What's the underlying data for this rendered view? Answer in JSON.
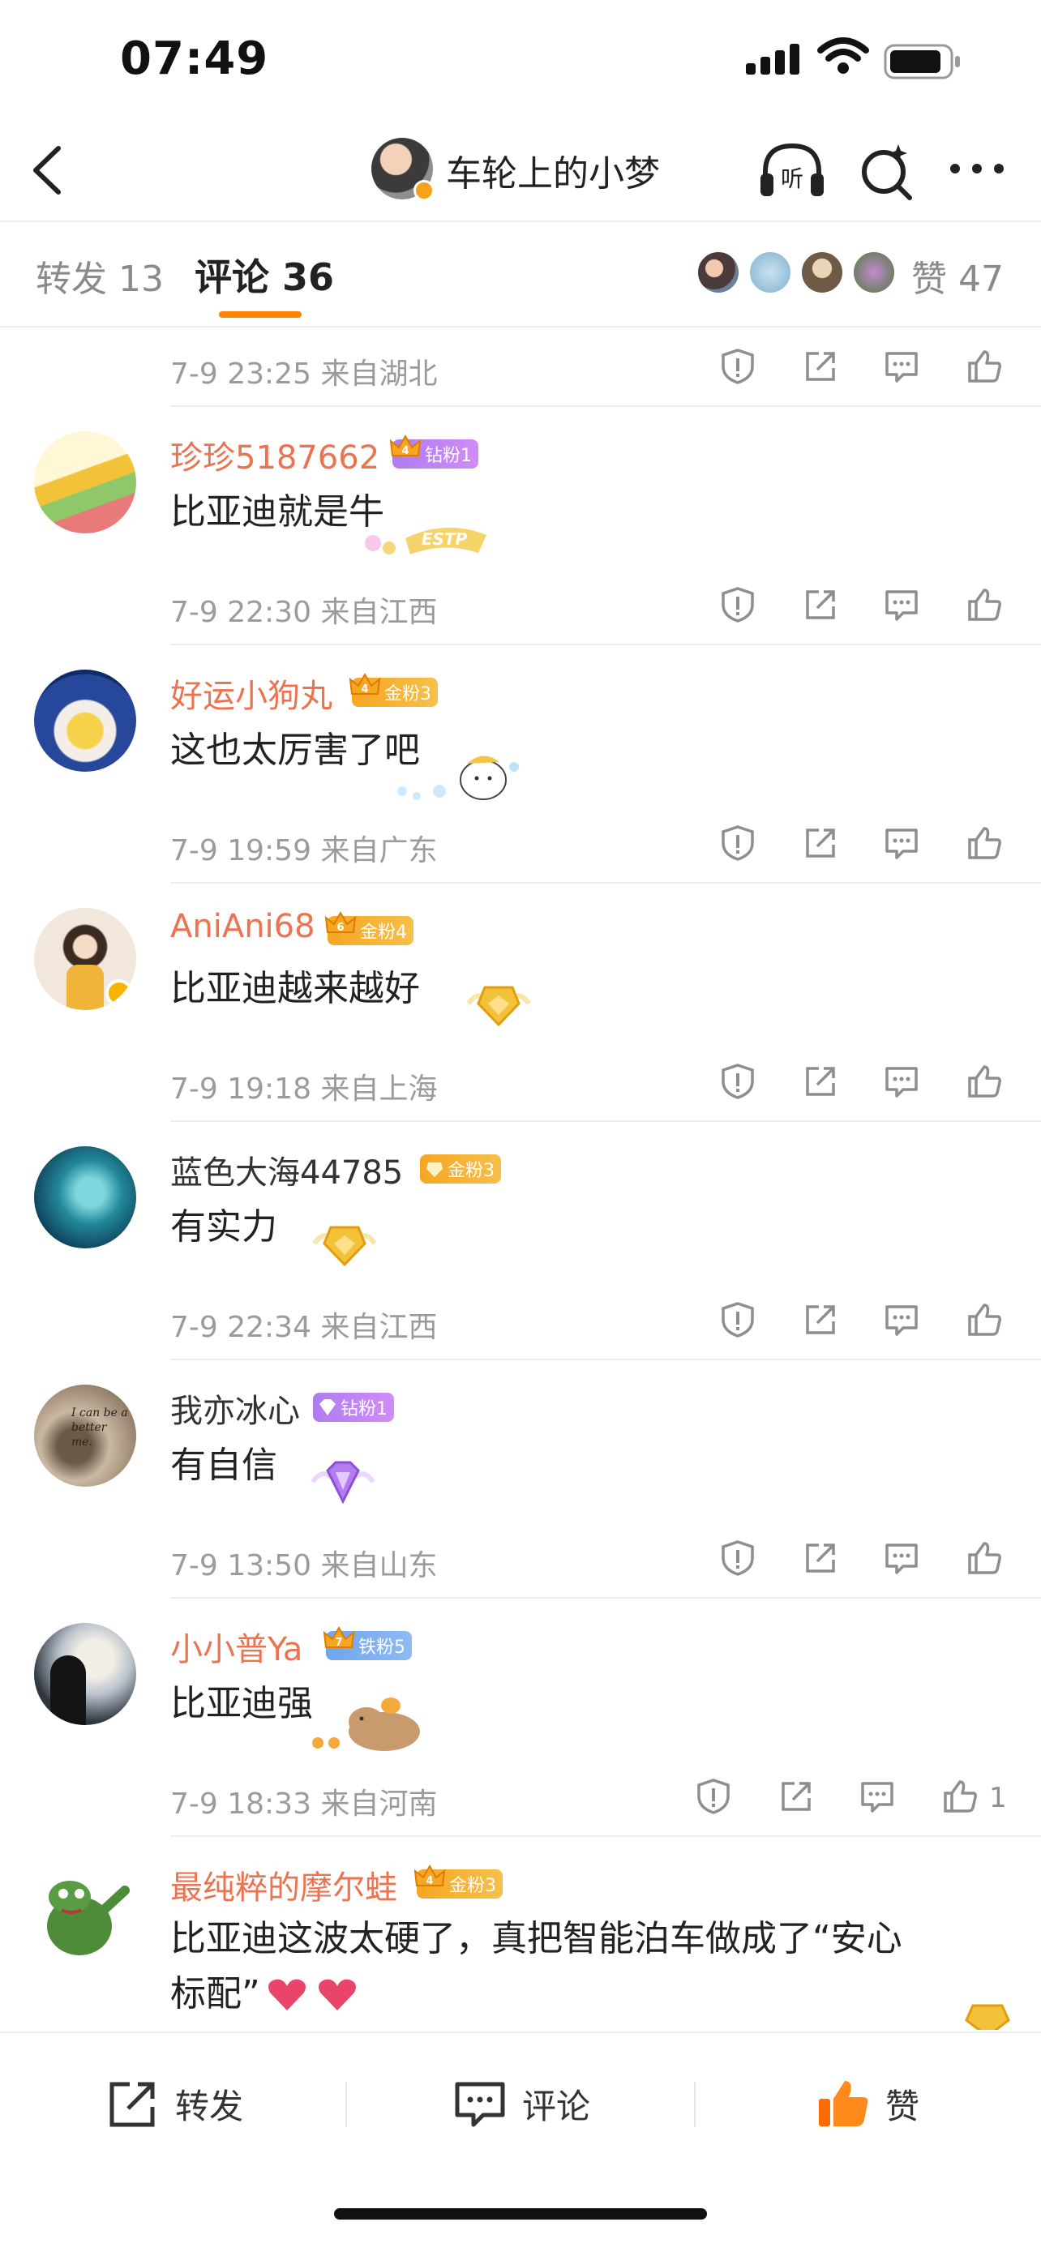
{
  "status": {
    "time": "07:49"
  },
  "nav": {
    "title": "车轮上的小梦",
    "listen_label": "听"
  },
  "tabs": {
    "repost": "转发 13",
    "comment": "评论 36",
    "likes": "赞 47"
  },
  "colors": {
    "accent": "#ff8200",
    "name_orange": "#eb7350",
    "like_orange": "#ff6b00"
  },
  "first_meta": {
    "time": "7-9 23:25",
    "location": "来自湖北"
  },
  "comments": [
    {
      "name": "珍珍5187662",
      "badge": "钻粉1",
      "badge_level": "4",
      "text": "比亚迪就是牛",
      "time": "7-9 22:30",
      "location": "来自江西",
      "sticker": "ESTP"
    },
    {
      "name": "好运小狗丸",
      "badge": "金粉3",
      "badge_level": "4",
      "text": "这也太厉害了吧",
      "time": "7-9 19:59",
      "location": "来自广东"
    },
    {
      "name": "AniAni68",
      "badge": "金粉4",
      "badge_level": "6",
      "text": "比亚迪越来越好",
      "time": "7-9 19:18",
      "location": "来自上海"
    },
    {
      "name": "蓝色大海44785",
      "badge": "金粉3",
      "text": "有实力",
      "time": "7-9 22:34",
      "location": "来自江西"
    },
    {
      "name": "我亦冰心",
      "badge": "钻粉1",
      "text": "有自信",
      "time": "7-9 13:50",
      "location": "来自山东",
      "avatar_text": "I can be a better me."
    },
    {
      "name": "小小普Ya",
      "badge": "铁粉5",
      "badge_level": "7",
      "text": "比亚迪强",
      "time": "7-9 18:33",
      "location": "来自河南",
      "like_count": "1"
    },
    {
      "name": "最纯粹的摩尔蛙",
      "badge": "金粉3",
      "badge_level": "4",
      "text_line1": "比亚迪这波太硬了，真把智能泊车做成了“安心",
      "text_line2": "标配”"
    }
  ],
  "bottom": {
    "repost": "转发",
    "comment": "评论",
    "like": "赞"
  },
  "icons": [
    "back-icon",
    "headphones-icon",
    "search-sparkle-icon",
    "more-icon",
    "report-icon",
    "share-icon",
    "reply-icon",
    "like-icon"
  ]
}
